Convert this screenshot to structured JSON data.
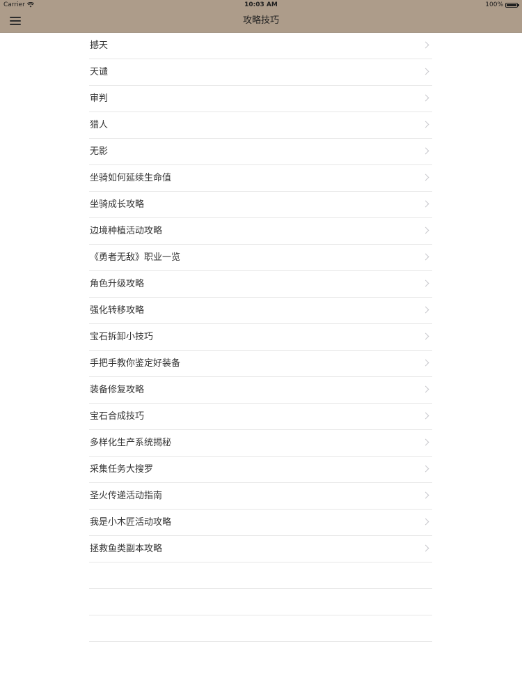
{
  "status_bar": {
    "carrier": "Carrier",
    "wifi_icon": "wifi-icon",
    "time": "10:03 AM",
    "battery_percent": "100%",
    "battery_level": 1.0
  },
  "nav_bar": {
    "menu_icon": "hamburger-menu-icon",
    "title": "攻略技巧",
    "background_color": "#ad9c8a"
  },
  "list": {
    "chevron_icon": "chevron-right-icon",
    "items": [
      {
        "label": "撼天"
      },
      {
        "label": "天谴"
      },
      {
        "label": "审判"
      },
      {
        "label": "猎人"
      },
      {
        "label": "无影"
      },
      {
        "label": "坐骑如何延续生命值"
      },
      {
        "label": "坐骑成长攻略"
      },
      {
        "label": "边境种植活动攻略"
      },
      {
        "label": "《勇者无敌》职业一览"
      },
      {
        "label": "角色升级攻略"
      },
      {
        "label": "强化转移攻略"
      },
      {
        "label": "宝石拆卸小技巧"
      },
      {
        "label": "手把手教你鉴定好装备"
      },
      {
        "label": "装备修复攻略"
      },
      {
        "label": "宝石合成技巧"
      },
      {
        "label": "多样化生产系统揭秘"
      },
      {
        "label": "采集任务大搜罗"
      },
      {
        "label": "圣火传递活动指南"
      },
      {
        "label": "我是小木匠活动攻略"
      },
      {
        "label": "拯救鱼类副本攻略"
      }
    ]
  }
}
